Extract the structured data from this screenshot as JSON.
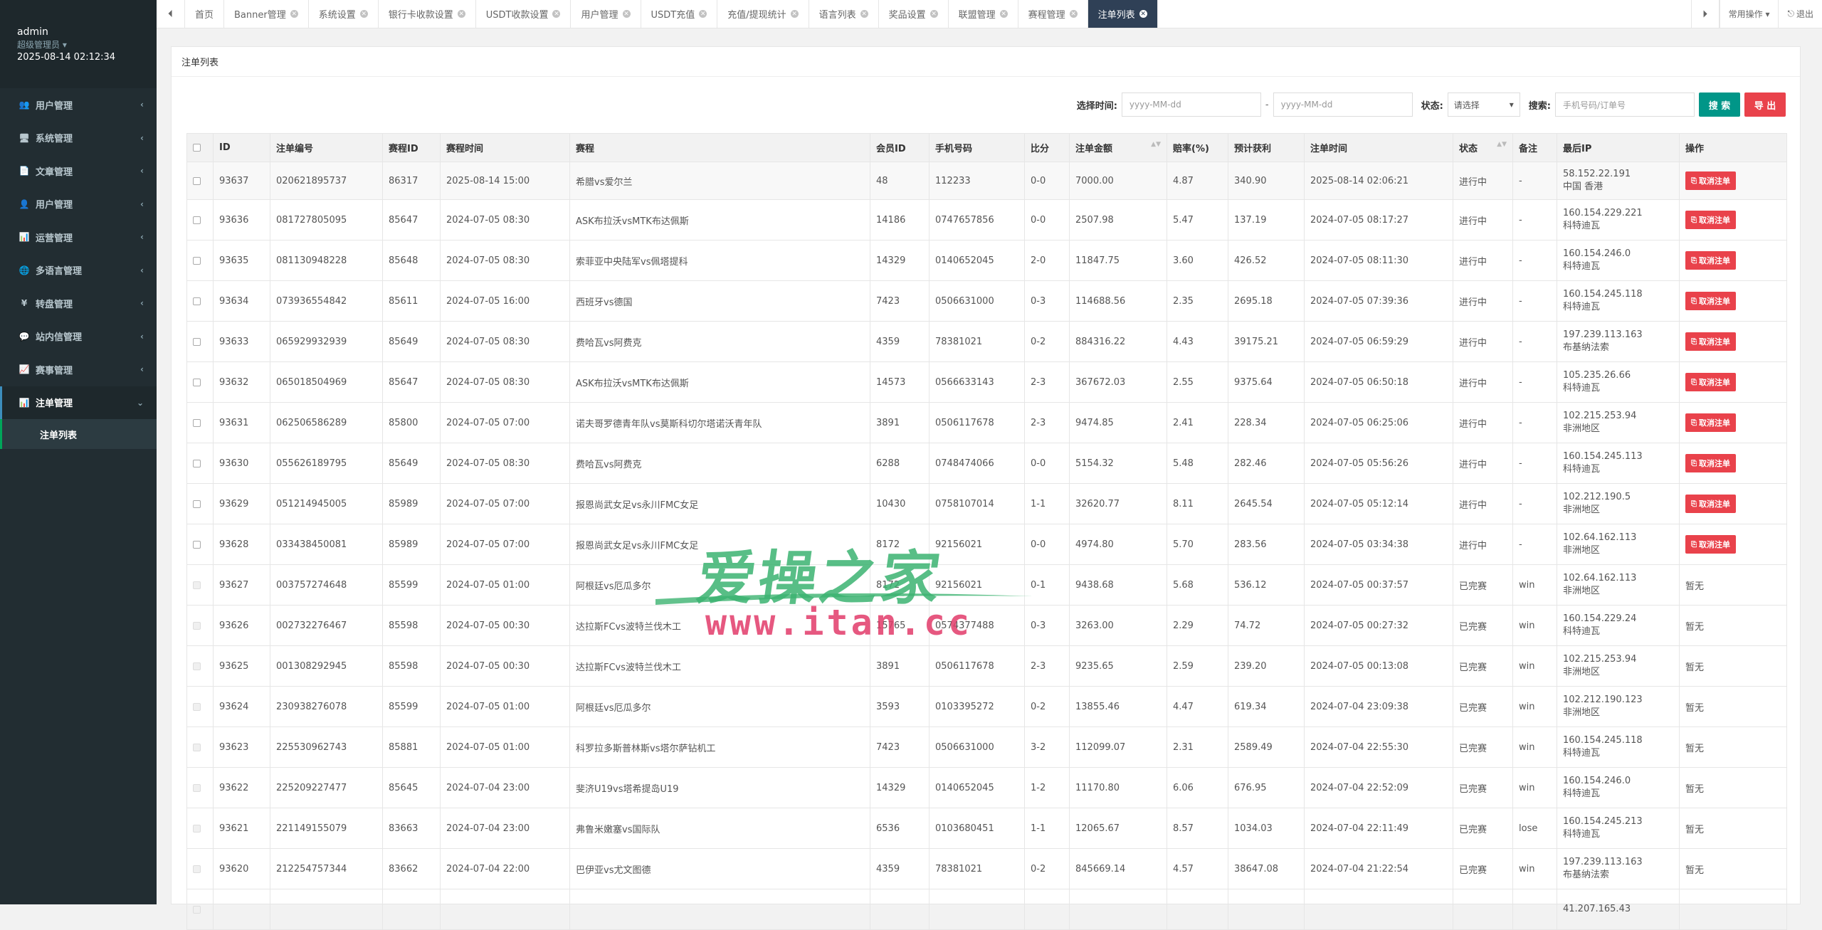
{
  "sidebar": {
    "user": {
      "name": "admin",
      "role": "超级管理员 ▾",
      "time": "2025-08-14 02:12:34"
    },
    "menu": [
      {
        "icon": "users-icon",
        "glyph": "👥",
        "label": "用户管理"
      },
      {
        "icon": "monitor-icon",
        "glyph": "🖥",
        "label": "系统管理"
      },
      {
        "icon": "file-icon",
        "glyph": "📄",
        "label": "文章管理"
      },
      {
        "icon": "user-icon",
        "glyph": "👤",
        "label": "用户管理"
      },
      {
        "icon": "bar-chart-icon",
        "glyph": "📊",
        "label": "运营管理"
      },
      {
        "icon": "globe-icon",
        "glyph": "🌐",
        "label": "多语言管理"
      },
      {
        "icon": "yen-icon",
        "glyph": "¥",
        "label": "转盘管理"
      },
      {
        "icon": "comment-icon",
        "glyph": "💬",
        "label": "站内信管理"
      },
      {
        "icon": "area-chart-icon",
        "glyph": "📈",
        "label": "赛事管理"
      },
      {
        "icon": "bar-chart-icon",
        "glyph": "📊",
        "label": "注单管理"
      }
    ],
    "submenu": [
      {
        "label": "注单列表"
      }
    ]
  },
  "topbar": {
    "tabs": [
      {
        "label": "首页",
        "closable": false
      },
      {
        "label": "Banner管理",
        "closable": true
      },
      {
        "label": "系统设置",
        "closable": true
      },
      {
        "label": "银行卡收款设置",
        "closable": true
      },
      {
        "label": "USDT收款设置",
        "closable": true
      },
      {
        "label": "用户管理",
        "closable": true
      },
      {
        "label": "USDT充值",
        "closable": true
      },
      {
        "label": "充值/提现统计",
        "closable": true
      },
      {
        "label": "语言列表",
        "closable": true
      },
      {
        "label": "奖品设置",
        "closable": true
      },
      {
        "label": "联盟管理",
        "closable": true
      },
      {
        "label": "赛程管理",
        "closable": true
      },
      {
        "label": "注单列表",
        "closable": true,
        "active": true
      }
    ],
    "common_ops": "常用操作 ▾",
    "logout": "退出"
  },
  "panel": {
    "title": "注单列表"
  },
  "search": {
    "time_label": "选择时间:",
    "date_from_placeholder": "yyyy-MM-dd",
    "date_sep": "-",
    "date_to_placeholder": "yyyy-MM-dd",
    "status_label": "状态:",
    "status_value": "请选择",
    "keyword_label": "搜索:",
    "keyword_placeholder": "手机号码/订单号",
    "search_btn": "搜 索",
    "export_btn": "导 出"
  },
  "table": {
    "headers": [
      "ID",
      "注单编号",
      "赛程ID",
      "赛程时间",
      "赛程",
      "会员ID",
      "手机号码",
      "比分",
      "注单金额",
      "赔率(%)",
      "预计获利",
      "注单时间",
      "状态",
      "备注",
      "最后IP",
      "操作"
    ],
    "cancel_label": "取消注单",
    "rows": [
      {
        "id": "93637",
        "no": "020621895737",
        "mid": "86317",
        "mtime": "2025-08-14 15:00",
        "match": "希腊vs爱尔兰",
        "uid": "48",
        "phone": "112233",
        "score": "0-0",
        "amount": "7000.00",
        "odds": "4.87",
        "profit": "340.90",
        "btime": "2025-08-14 02:06:21",
        "status": "进行中",
        "note": "-",
        "ip1": "58.152.22.191",
        "ip2": "中国 香港",
        "op": "cancel"
      },
      {
        "id": "93636",
        "no": "081727805095",
        "mid": "85647",
        "mtime": "2024-07-05 08:30",
        "match": "ASK布拉沃vsMTK布达佩斯",
        "uid": "14186",
        "phone": "0747657856",
        "score": "0-0",
        "amount": "2507.98",
        "odds": "5.47",
        "profit": "137.19",
        "btime": "2024-07-05 08:17:27",
        "status": "进行中",
        "note": "-",
        "ip1": "160.154.229.221",
        "ip2": "科特迪瓦",
        "op": "cancel"
      },
      {
        "id": "93635",
        "no": "081130948228",
        "mid": "85648",
        "mtime": "2024-07-05 08:30",
        "match": "索菲亚中央陆军vs佩塔提科",
        "uid": "14329",
        "phone": "0140652045",
        "score": "2-0",
        "amount": "11847.75",
        "odds": "3.60",
        "profit": "426.52",
        "btime": "2024-07-05 08:11:30",
        "status": "进行中",
        "note": "-",
        "ip1": "160.154.246.0",
        "ip2": "科特迪瓦",
        "op": "cancel"
      },
      {
        "id": "93634",
        "no": "073936554842",
        "mid": "85611",
        "mtime": "2024-07-05 16:00",
        "match": "西班牙vs德国",
        "uid": "7423",
        "phone": "0506631000",
        "score": "0-3",
        "amount": "114688.56",
        "odds": "2.35",
        "profit": "2695.18",
        "btime": "2024-07-05 07:39:36",
        "status": "进行中",
        "note": "-",
        "ip1": "160.154.245.118",
        "ip2": "科特迪瓦",
        "op": "cancel"
      },
      {
        "id": "93633",
        "no": "065929932939",
        "mid": "85649",
        "mtime": "2024-07-05 08:30",
        "match": "费哈瓦vs阿费克",
        "uid": "4359",
        "phone": "78381021",
        "score": "0-2",
        "amount": "884316.22",
        "odds": "4.43",
        "profit": "39175.21",
        "btime": "2024-07-05 06:59:29",
        "status": "进行中",
        "note": "-",
        "ip1": "197.239.113.163",
        "ip2": "布基纳法索",
        "op": "cancel"
      },
      {
        "id": "93632",
        "no": "065018504969",
        "mid": "85647",
        "mtime": "2024-07-05 08:30",
        "match": "ASK布拉沃vsMTK布达佩斯",
        "uid": "14573",
        "phone": "0566633143",
        "score": "2-3",
        "amount": "367672.03",
        "odds": "2.55",
        "profit": "9375.64",
        "btime": "2024-07-05 06:50:18",
        "status": "进行中",
        "note": "-",
        "ip1": "105.235.26.66",
        "ip2": "科特迪瓦",
        "op": "cancel"
      },
      {
        "id": "93631",
        "no": "062506586289",
        "mid": "85800",
        "mtime": "2024-07-05 07:00",
        "match": "诺夫哥罗德青年队vs莫斯科切尔塔诺沃青年队",
        "uid": "3891",
        "phone": "0506117678",
        "score": "2-3",
        "amount": "9474.85",
        "odds": "2.41",
        "profit": "228.34",
        "btime": "2024-07-05 06:25:06",
        "status": "进行中",
        "note": "-",
        "ip1": "102.215.253.94",
        "ip2": "非洲地区",
        "op": "cancel"
      },
      {
        "id": "93630",
        "no": "055626189795",
        "mid": "85649",
        "mtime": "2024-07-05 08:30",
        "match": "费哈瓦vs阿费克",
        "uid": "6288",
        "phone": "0748474066",
        "score": "0-0",
        "amount": "5154.32",
        "odds": "5.48",
        "profit": "282.46",
        "btime": "2024-07-05 05:56:26",
        "status": "进行中",
        "note": "-",
        "ip1": "160.154.245.113",
        "ip2": "科特迪瓦",
        "op": "cancel"
      },
      {
        "id": "93629",
        "no": "051214945005",
        "mid": "85989",
        "mtime": "2024-07-05 07:00",
        "match": "报恩尚武女足vs永川FMC女足",
        "uid": "10430",
        "phone": "0758107014",
        "score": "1-1",
        "amount": "32620.77",
        "odds": "8.11",
        "profit": "2645.54",
        "btime": "2024-07-05 05:12:14",
        "status": "进行中",
        "note": "-",
        "ip1": "102.212.190.5",
        "ip2": "非洲地区",
        "op": "cancel"
      },
      {
        "id": "93628",
        "no": "033438450081",
        "mid": "85989",
        "mtime": "2024-07-05 07:00",
        "match": "报恩尚武女足vs永川FMC女足",
        "uid": "8172",
        "phone": "92156021",
        "score": "0-0",
        "amount": "4974.80",
        "odds": "5.70",
        "profit": "283.56",
        "btime": "2024-07-05 03:34:38",
        "status": "进行中",
        "note": "-",
        "ip1": "102.64.162.113",
        "ip2": "非洲地区",
        "op": "cancel"
      },
      {
        "id": "93627",
        "no": "003757274648",
        "mid": "85599",
        "mtime": "2024-07-05 01:00",
        "match": "阿根廷vs厄瓜多尔",
        "uid": "8172",
        "phone": "92156021",
        "score": "0-1",
        "amount": "9438.68",
        "odds": "5.68",
        "profit": "536.12",
        "btime": "2024-07-05 00:37:57",
        "status": "已完赛",
        "note": "win",
        "ip1": "102.64.162.113",
        "ip2": "非洲地区",
        "op": "暂无"
      },
      {
        "id": "93626",
        "no": "002732276467",
        "mid": "85598",
        "mtime": "2024-07-05 00:30",
        "match": "达拉斯FCvs波特兰伐木工",
        "uid": "15765",
        "phone": "0574377488",
        "score": "0-3",
        "amount": "3263.00",
        "odds": "2.29",
        "profit": "74.72",
        "btime": "2024-07-05 00:27:32",
        "status": "已完赛",
        "note": "win",
        "ip1": "160.154.229.24",
        "ip2": "科特迪瓦",
        "op": "暂无"
      },
      {
        "id": "93625",
        "no": "001308292945",
        "mid": "85598",
        "mtime": "2024-07-05 00:30",
        "match": "达拉斯FCvs波特兰伐木工",
        "uid": "3891",
        "phone": "0506117678",
        "score": "2-3",
        "amount": "9235.65",
        "odds": "2.59",
        "profit": "239.20",
        "btime": "2024-07-05 00:13:08",
        "status": "已完赛",
        "note": "win",
        "ip1": "102.215.253.94",
        "ip2": "非洲地区",
        "op": "暂无"
      },
      {
        "id": "93624",
        "no": "230938276078",
        "mid": "85599",
        "mtime": "2024-07-05 01:00",
        "match": "阿根廷vs厄瓜多尔",
        "uid": "3593",
        "phone": "0103395272",
        "score": "0-2",
        "amount": "13855.46",
        "odds": "4.47",
        "profit": "619.34",
        "btime": "2024-07-04 23:09:38",
        "status": "已完赛",
        "note": "win",
        "ip1": "102.212.190.123",
        "ip2": "非洲地区",
        "op": "暂无"
      },
      {
        "id": "93623",
        "no": "225530962743",
        "mid": "85881",
        "mtime": "2024-07-05 01:00",
        "match": "科罗拉多斯普林斯vs塔尔萨钻机工",
        "uid": "7423",
        "phone": "0506631000",
        "score": "3-2",
        "amount": "112099.07",
        "odds": "2.31",
        "profit": "2589.49",
        "btime": "2024-07-04 22:55:30",
        "status": "已完赛",
        "note": "win",
        "ip1": "160.154.245.118",
        "ip2": "科特迪瓦",
        "op": "暂无"
      },
      {
        "id": "93622",
        "no": "225209227477",
        "mid": "85645",
        "mtime": "2024-07-04 23:00",
        "match": "斐济U19vs塔希提岛U19",
        "uid": "14329",
        "phone": "0140652045",
        "score": "1-2",
        "amount": "11170.80",
        "odds": "6.06",
        "profit": "676.95",
        "btime": "2024-07-04 22:52:09",
        "status": "已完赛",
        "note": "win",
        "ip1": "160.154.246.0",
        "ip2": "科特迪瓦",
        "op": "暂无"
      },
      {
        "id": "93621",
        "no": "221149155079",
        "mid": "83663",
        "mtime": "2024-07-04 23:00",
        "match": "弗鲁米嫩塞vs国际队",
        "uid": "6536",
        "phone": "0103680451",
        "score": "1-1",
        "amount": "12065.67",
        "odds": "8.57",
        "profit": "1034.03",
        "btime": "2024-07-04 22:11:49",
        "status": "已完赛",
        "note": "lose",
        "ip1": "160.154.245.213",
        "ip2": "科特迪瓦",
        "op": "暂无"
      },
      {
        "id": "93620",
        "no": "212254757344",
        "mid": "83662",
        "mtime": "2024-07-04 22:00",
        "match": "巴伊亚vs尤文图德",
        "uid": "4359",
        "phone": "78381021",
        "score": "0-2",
        "amount": "845669.14",
        "odds": "4.57",
        "profit": "38647.08",
        "btime": "2024-07-04 21:22:54",
        "status": "已完赛",
        "note": "win",
        "ip1": "197.239.113.163",
        "ip2": "布基纳法索",
        "op": "暂无"
      },
      {
        "id": "",
        "no": "",
        "mid": "",
        "mtime": "",
        "match": "",
        "uid": "",
        "phone": "",
        "score": "",
        "amount": "",
        "odds": "",
        "profit": "",
        "btime": "",
        "status": "",
        "note": "",
        "ip1": "41.207.165.43",
        "ip2": "",
        "op": ""
      }
    ]
  },
  "watermark": {
    "text": "爱操之家",
    "url": "www.itan.cc"
  }
}
